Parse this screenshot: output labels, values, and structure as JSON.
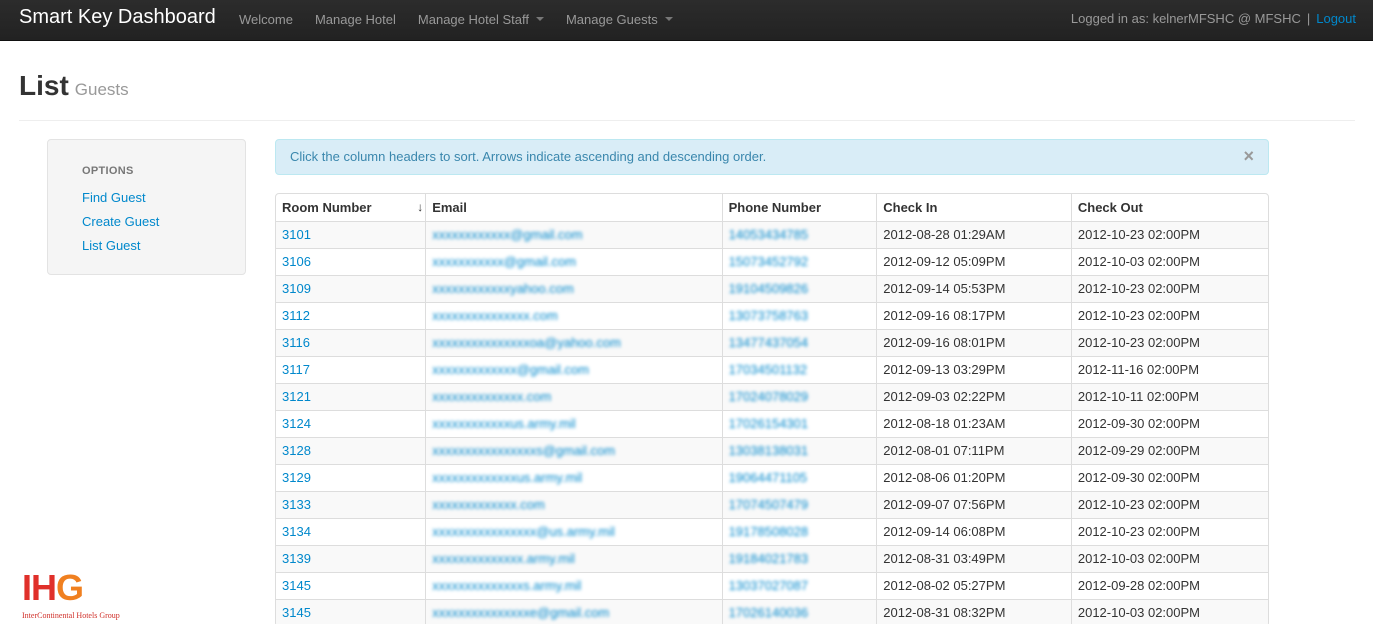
{
  "navbar": {
    "brand": "Smart Key Dashboard",
    "items": [
      {
        "label": "Welcome",
        "dropdown": false
      },
      {
        "label": "Manage Hotel",
        "dropdown": false
      },
      {
        "label": "Manage Hotel Staff",
        "dropdown": true
      },
      {
        "label": "Manage Guests",
        "dropdown": true
      }
    ],
    "logged_in_text": "Logged in as: kelnerMFSHC @ MFSHC",
    "separator": "|",
    "logout_label": "Logout"
  },
  "header": {
    "title": "List",
    "subtitle": "Guests"
  },
  "sidebar": {
    "header": "OPTIONS",
    "links": [
      "Find Guest",
      "Create Guest",
      "List Guest"
    ]
  },
  "alert": {
    "message": "Click the column headers to sort. Arrows indicate ascending and descending order.",
    "close": "×"
  },
  "table": {
    "sort_indicator": "↓",
    "columns": [
      "Room Number",
      "Email",
      "Phone Number",
      "Check In",
      "Check Out"
    ],
    "rows": [
      {
        "room": "3101",
        "email": "xxxxxxxxxxxx@gmail.com",
        "phone": "14053434785",
        "check_in": "2012-08-28 01:29AM",
        "check_out": "2012-10-23 02:00PM"
      },
      {
        "room": "3106",
        "email": "xxxxxxxxxxx@gmail.com",
        "phone": "15073452792",
        "check_in": "2012-09-12 05:09PM",
        "check_out": "2012-10-03 02:00PM"
      },
      {
        "room": "3109",
        "email": "xxxxxxxxxxxxyahoo.com",
        "phone": "19104509826",
        "check_in": "2012-09-14 05:53PM",
        "check_out": "2012-10-23 02:00PM"
      },
      {
        "room": "3112",
        "email": "xxxxxxxxxxxxxxx.com",
        "phone": "13073758763",
        "check_in": "2012-09-16 08:17PM",
        "check_out": "2012-10-23 02:00PM"
      },
      {
        "room": "3116",
        "email": "xxxxxxxxxxxxxxxoa@yahoo.com",
        "phone": "13477437054",
        "check_in": "2012-09-16 08:01PM",
        "check_out": "2012-10-23 02:00PM"
      },
      {
        "room": "3117",
        "email": "xxxxxxxxxxxxx@gmail.com",
        "phone": "17034501132",
        "check_in": "2012-09-13 03:29PM",
        "check_out": "2012-11-16 02:00PM"
      },
      {
        "room": "3121",
        "email": "xxxxxxxxxxxxxx.com",
        "phone": "17024078029",
        "check_in": "2012-09-03 02:22PM",
        "check_out": "2012-10-11 02:00PM"
      },
      {
        "room": "3124",
        "email": "xxxxxxxxxxxxus.army.mil",
        "phone": "17026154301",
        "check_in": "2012-08-18 01:23AM",
        "check_out": "2012-09-30 02:00PM"
      },
      {
        "room": "3128",
        "email": "xxxxxxxxxxxxxxxxs@gmail.com",
        "phone": "13038138031",
        "check_in": "2012-08-01 07:11PM",
        "check_out": "2012-09-29 02:00PM"
      },
      {
        "room": "3129",
        "email": "xxxxxxxxxxxxxus.army.mil",
        "phone": "19064471105",
        "check_in": "2012-08-06 01:20PM",
        "check_out": "2012-09-30 02:00PM"
      },
      {
        "room": "3133",
        "email": "xxxxxxxxxxxxx.com",
        "phone": "17074507479",
        "check_in": "2012-09-07 07:56PM",
        "check_out": "2012-10-23 02:00PM"
      },
      {
        "room": "3134",
        "email": "xxxxxxxxxxxxxxxx@us.army.mil",
        "phone": "19178508028",
        "check_in": "2012-09-14 06:08PM",
        "check_out": "2012-10-23 02:00PM"
      },
      {
        "room": "3139",
        "email": "xxxxxxxxxxxxxx.army.mil",
        "phone": "19184021783",
        "check_in": "2012-08-31 03:49PM",
        "check_out": "2012-10-03 02:00PM"
      },
      {
        "room": "3145",
        "email": "xxxxxxxxxxxxxxs.army.mil",
        "phone": "13037027087",
        "check_in": "2012-08-02 05:27PM",
        "check_out": "2012-09-28 02:00PM"
      },
      {
        "room": "3145",
        "email": "xxxxxxxxxxxxxxxe@gmail.com",
        "phone": "17026140036",
        "check_in": "2012-08-31 08:32PM",
        "check_out": "2012-10-03 02:00PM"
      }
    ]
  },
  "logo": {
    "mark_left": "IH",
    "mark_right": "G",
    "tagline": "InterContinental Hotels Group"
  }
}
